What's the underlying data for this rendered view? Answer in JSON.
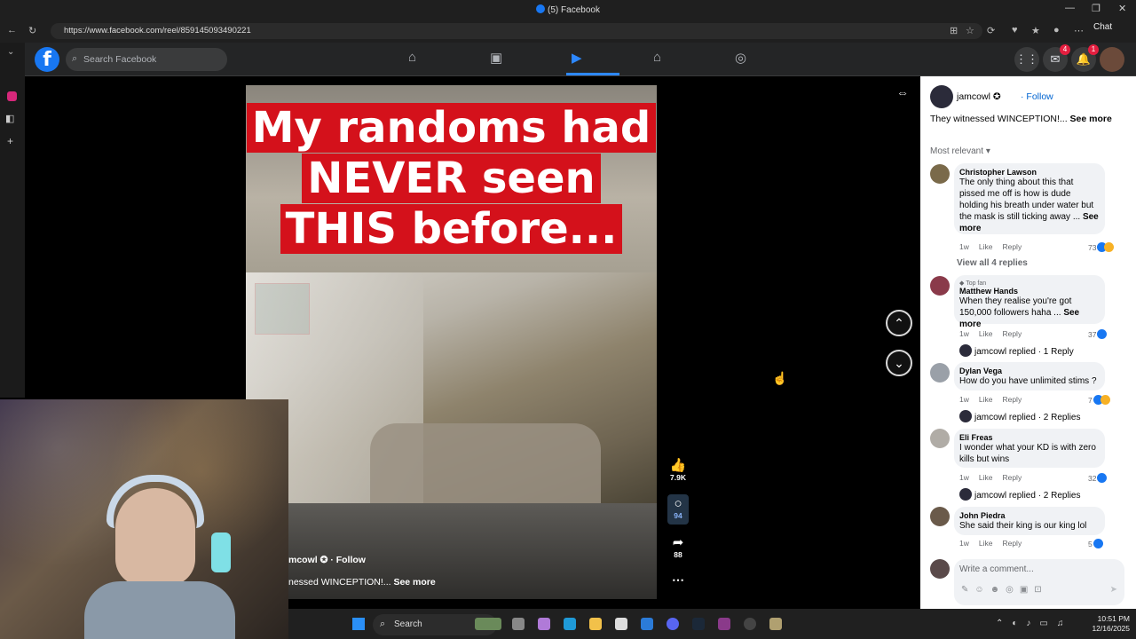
{
  "browser": {
    "title": "(5) Facebook",
    "url": "https://www.facebook.com/reel/859145093490221",
    "chat_label": "Chat"
  },
  "facebook": {
    "search_placeholder": "Search Facebook",
    "nav_icons": [
      "home-icon",
      "video-icon",
      "reels-icon",
      "marketplace-icon",
      "gaming-icon"
    ],
    "menu_icon": "grid-icon",
    "messenger_badge": "4",
    "notifications_badge": "1"
  },
  "reel": {
    "headline_lines": [
      "My randoms had",
      "NEVER seen",
      "THIS before..."
    ],
    "caption_author": "mcowl",
    "caption_follow": "Follow",
    "caption_text": "nessed WINCEPTION!...",
    "caption_see_more": "See more",
    "likes": "7.9K",
    "comments": "94",
    "shares": "88"
  },
  "panel": {
    "author": "jamcowl",
    "follow": "· Follow",
    "description": "They witnessed WINCEPTION!...",
    "see_more": "See more",
    "sort": "Most relevant",
    "comments": [
      {
        "name": "Christopher Lawson",
        "text": "The only thing about this that pissed me off is how is dude holding his breath under water but the mask is still ticking away ...",
        "more": "See more",
        "age": "1w",
        "like": "Like",
        "reply": "Reply",
        "reactions": "73",
        "view_replies": "View all 4 replies"
      },
      {
        "badge": "Top fan",
        "name": "Matthew Hands",
        "text": "When they realise you're got 150,000 followers haha ...",
        "more": "See more",
        "age": "1w",
        "like": "Like",
        "reply": "Reply",
        "reactions": "37",
        "author_reply": "jamcowl replied · 1 Reply"
      },
      {
        "name": "Dylan Vega",
        "text": "How do you have unlimited stims ?",
        "age": "1w",
        "like": "Like",
        "reply": "Reply",
        "reactions": "7",
        "author_reply": "jamcowl replied · 2 Replies"
      },
      {
        "name": "Eli Freas",
        "text": "I wonder what your KD is with zero kills but wins",
        "age": "1w",
        "like": "Like",
        "reply": "Reply",
        "reactions": "32",
        "author_reply": "jamcowl replied · 2 Replies"
      },
      {
        "name": "John Piedra",
        "text": "She said their king is our king lol",
        "age": "1w",
        "like": "Like",
        "reply": "Reply",
        "reactions": "5"
      }
    ],
    "write_placeholder": "Write a comment..."
  },
  "taskbar": {
    "search_label": "Search",
    "time": "10:51 PM",
    "date": "12/16/2025"
  }
}
